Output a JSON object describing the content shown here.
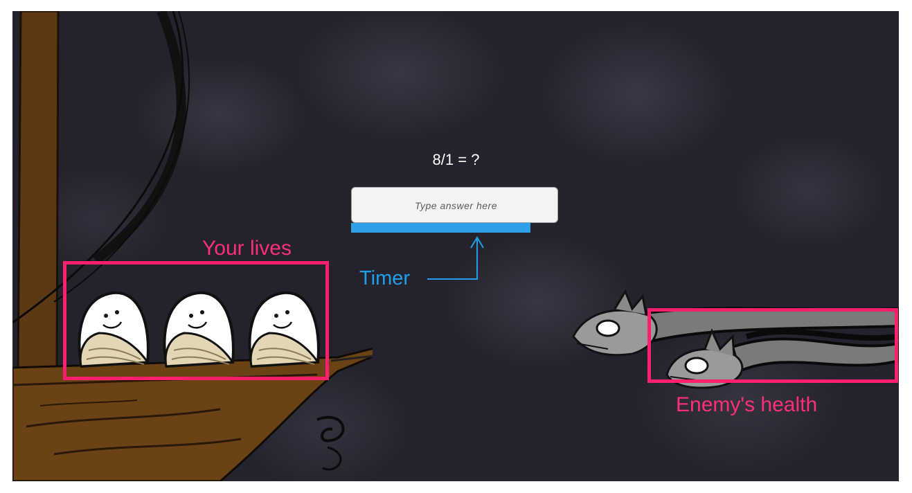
{
  "game": {
    "question": "8/1 = ?",
    "answer_placeholder": "Type answer here",
    "timer_progress": 0.87
  },
  "annotations": {
    "lives_label": "Your lives",
    "timer_label": "Timer",
    "enemy_label": "Enemy's health"
  },
  "player": {
    "lives": 3
  },
  "colors": {
    "background": "#24232d",
    "timer_fill": "#2f9fe8",
    "highlight": "#ff1f6e",
    "annotation_blue": "#1ea1ea",
    "ship_wood": "#5a3512"
  }
}
